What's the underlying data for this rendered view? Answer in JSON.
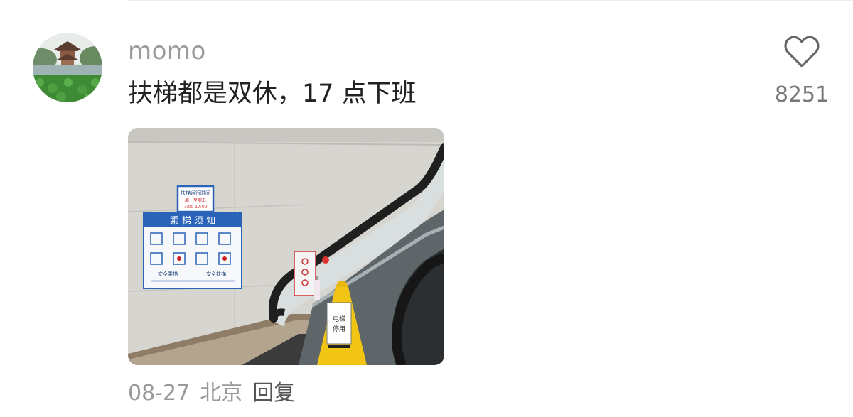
{
  "comment": {
    "username": "momo",
    "text": "扶梯都是双休，17 点下班",
    "likes": "8251",
    "date": "08-27",
    "location": "北京",
    "reply_label": "回复"
  },
  "photo": {
    "sign_hours_title": "扶梯运行时间",
    "sign_hours_days": "周一至周五",
    "sign_hours_time": "7:00-17:00",
    "sign_notice_title": "乘 梯 须 知",
    "sign_notice_left": "安全乘梯",
    "sign_notice_right": "安全扶梯",
    "caution_sign_line1": "电梯",
    "caution_sign_line2": "停用"
  },
  "icons": {
    "like": "heart-outline-icon"
  },
  "colors": {
    "username": "#9b9b9b",
    "text": "#222222",
    "meta": "#999999",
    "sign_blue": "#2a63b8",
    "caution_yellow": "#f2c515"
  }
}
